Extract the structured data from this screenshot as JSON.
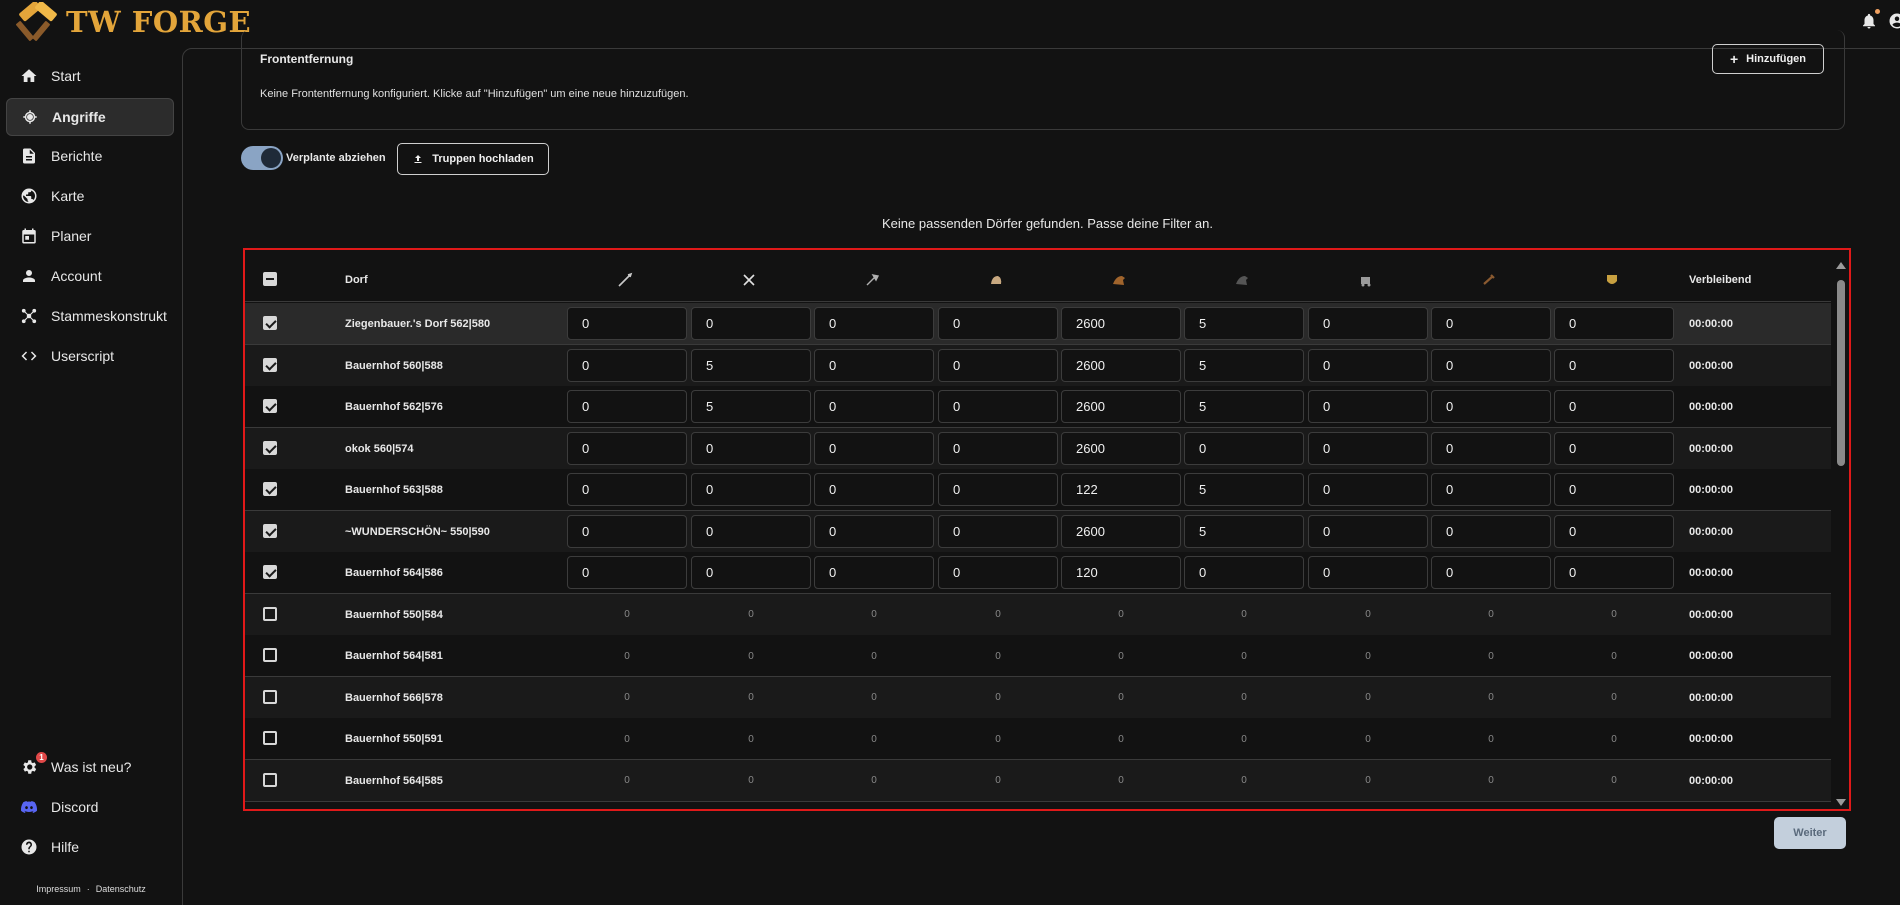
{
  "app": {
    "title": "TW FORGE"
  },
  "nav": [
    {
      "label": "Start",
      "icon": "home-icon"
    },
    {
      "label": "Angriffe",
      "icon": "target-icon",
      "active": true
    },
    {
      "label": "Berichte",
      "icon": "document-icon"
    },
    {
      "label": "Karte",
      "icon": "globe-icon"
    },
    {
      "label": "Planer",
      "icon": "calendar-icon"
    },
    {
      "label": "Account",
      "icon": "person-icon"
    },
    {
      "label": "Stammeskonstrukt",
      "icon": "network-icon"
    },
    {
      "label": "Userscript",
      "icon": "code-icon"
    }
  ],
  "bottom_nav": [
    {
      "label": "Was ist neu?",
      "icon": "gear-icon",
      "badge": "1"
    },
    {
      "label": "Discord",
      "icon": "discord-icon"
    },
    {
      "label": "Hilfe",
      "icon": "help-icon"
    }
  ],
  "footer": {
    "impressum": "Impressum",
    "separator": "·",
    "datenschutz": "Datenschutz"
  },
  "front": {
    "title": "Frontentfernung",
    "add_label": "Hinzufügen",
    "empty_text": "Keine Frontentfernung konfiguriert. Klicke auf \"Hinzufügen\" um eine neue hinzuzufügen."
  },
  "controls": {
    "toggle_label": "Verplante abziehen",
    "upload_label": "Truppen hochladen"
  },
  "empty_message": "Keine passenden Dörfer gefunden. Passe deine Filter an.",
  "table": {
    "col_village": "Dorf",
    "col_remaining": "Verbleibend",
    "unit_icons": [
      "spear-icon",
      "sword-icon",
      "axe-icon",
      "spy-icon",
      "light-cavalry-icon",
      "heavy-cavalry-icon",
      "ram-icon",
      "catapult-icon",
      "noble-icon"
    ],
    "rows": [
      {
        "name": "Ziegenbauer.'s Dorf 562|580",
        "checked": true,
        "values": [
          "0",
          "0",
          "0",
          "0",
          "2600",
          "5",
          "0",
          "0",
          "0"
        ],
        "remaining": "00:00:00"
      },
      {
        "name": "Bauernhof 560|588",
        "checked": true,
        "values": [
          "0",
          "5",
          "0",
          "0",
          "2600",
          "5",
          "0",
          "0",
          "0"
        ],
        "remaining": "00:00:00"
      },
      {
        "name": "Bauernhof 562|576",
        "checked": true,
        "values": [
          "0",
          "5",
          "0",
          "0",
          "2600",
          "5",
          "0",
          "0",
          "0"
        ],
        "remaining": "00:00:00"
      },
      {
        "name": "okok 560|574",
        "checked": true,
        "values": [
          "0",
          "0",
          "0",
          "0",
          "2600",
          "0",
          "0",
          "0",
          "0"
        ],
        "remaining": "00:00:00"
      },
      {
        "name": "Bauernhof 563|588",
        "checked": true,
        "values": [
          "0",
          "0",
          "0",
          "0",
          "122",
          "5",
          "0",
          "0",
          "0"
        ],
        "remaining": "00:00:00"
      },
      {
        "name": "~WUNDERSCHÖN~ 550|590",
        "checked": true,
        "values": [
          "0",
          "0",
          "0",
          "0",
          "2600",
          "5",
          "0",
          "0",
          "0"
        ],
        "remaining": "00:00:00"
      },
      {
        "name": "Bauernhof 564|586",
        "checked": true,
        "values": [
          "0",
          "0",
          "0",
          "0",
          "120",
          "0",
          "0",
          "0",
          "0"
        ],
        "remaining": "00:00:00"
      },
      {
        "name": "Bauernhof 550|584",
        "checked": false,
        "values": [
          "0",
          "0",
          "0",
          "0",
          "0",
          "0",
          "0",
          "0",
          "0"
        ],
        "remaining": "00:00:00"
      },
      {
        "name": "Bauernhof 564|581",
        "checked": false,
        "values": [
          "0",
          "0",
          "0",
          "0",
          "0",
          "0",
          "0",
          "0",
          "0"
        ],
        "remaining": "00:00:00"
      },
      {
        "name": "Bauernhof 566|578",
        "checked": false,
        "values": [
          "0",
          "0",
          "0",
          "0",
          "0",
          "0",
          "0",
          "0",
          "0"
        ],
        "remaining": "00:00:00"
      },
      {
        "name": "Bauernhof 550|591",
        "checked": false,
        "values": [
          "0",
          "0",
          "0",
          "0",
          "0",
          "0",
          "0",
          "0",
          "0"
        ],
        "remaining": "00:00:00"
      },
      {
        "name": "Bauernhof 564|585",
        "checked": false,
        "values": [
          "0",
          "0",
          "0",
          "0",
          "0",
          "0",
          "0",
          "0",
          "0"
        ],
        "remaining": "00:00:00"
      }
    ]
  },
  "next_label": "Weiter",
  "colors": {
    "brand": "#e3a53a",
    "highlight_border": "#e01919",
    "toggle": "#8aa4c4"
  }
}
